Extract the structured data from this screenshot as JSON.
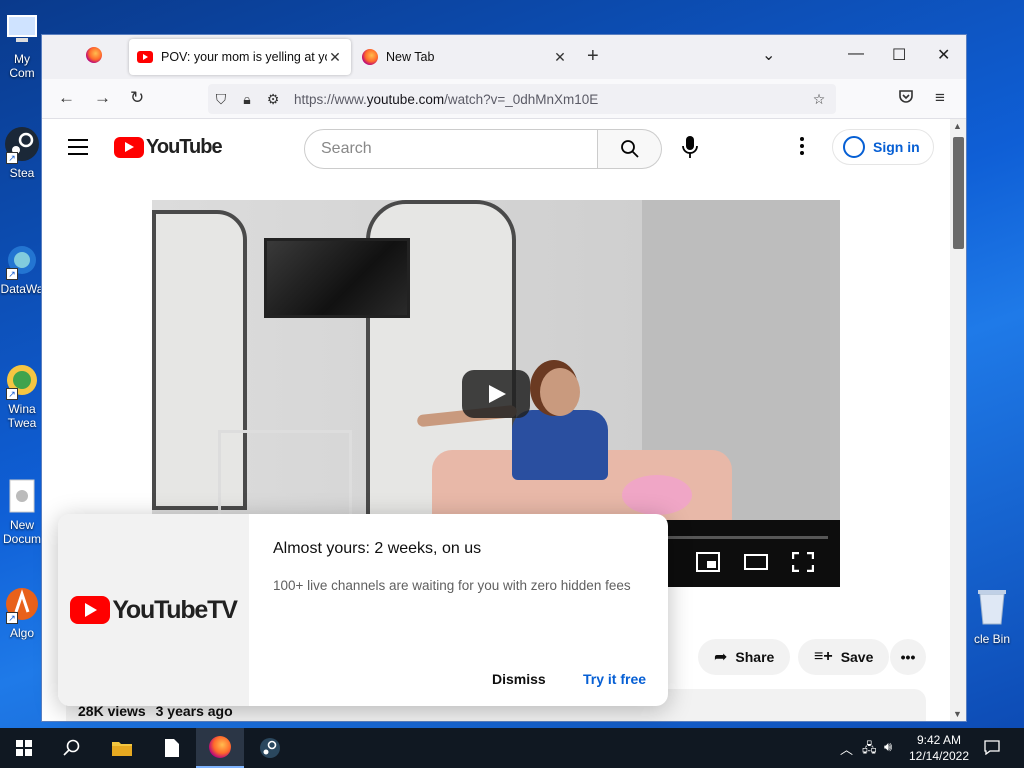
{
  "desktop": {
    "icons": [
      {
        "label": "My Com",
        "icon": "computer-icon"
      },
      {
        "label": "Stea",
        "icon": "steam-icon"
      },
      {
        "label": "DataWa",
        "icon": "datawarehouse-icon"
      },
      {
        "label": "Wina Twea",
        "icon": "winaero-tweaker-icon"
      },
      {
        "label": "New Docum",
        "icon": "document-icon"
      },
      {
        "label": "Algo",
        "icon": "algo-icon"
      }
    ],
    "recycle_bin": {
      "label": "cle Bin",
      "icon": "recycle-bin-icon"
    }
  },
  "browser": {
    "tabs": [
      {
        "title": "POV: your mom is yelling at you",
        "active": true,
        "favicon": "youtube-favicon"
      },
      {
        "title": "New Tab",
        "active": false,
        "favicon": "firefox-favicon"
      }
    ],
    "new_tab_symbol": "+",
    "url_prefix": "https://www.",
    "url_domain": "youtube.com",
    "url_suffix": "/watch?v=_0dhMnXm10E"
  },
  "youtube": {
    "logo_text": "YouTube",
    "search": {
      "placeholder": "Search"
    },
    "signin_label": "Sign in",
    "actions": {
      "share_label": "Share",
      "save_label": "Save"
    },
    "description": {
      "views": "28K views",
      "age": "3 years ago"
    }
  },
  "promo": {
    "logo_text": "YouTubeTV",
    "title": "Almost yours: 2 weeks, on us",
    "subtitle": "100+ live channels are waiting for you with zero hidden fees",
    "dismiss_label": "Dismiss",
    "try_label": "Try it free"
  },
  "taskbar": {
    "time": "9:42 AM",
    "date": "12/14/2022"
  },
  "colors": {
    "youtube_red": "#ff0000",
    "link_blue": "#065fd4",
    "desktop_blue": "#0f5fd6"
  }
}
